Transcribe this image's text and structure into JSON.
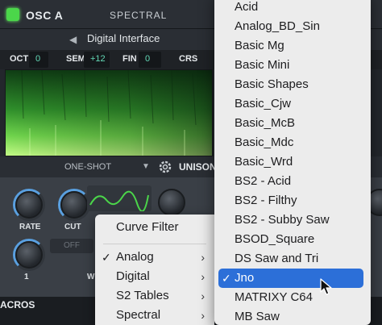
{
  "osc": {
    "title": "OSC A",
    "mode": "SPECTRAL",
    "wavetable": "Digital Interface",
    "oct_label": "OCT",
    "oct_value": "0",
    "sem_label": "SEM",
    "sem_value": "+12",
    "fin_label": "FIN",
    "fin_value": "0",
    "crs_label": "CRS",
    "playback": "ONE-SHOT",
    "unison": "UNISON",
    "accent_color": "#4bd64a"
  },
  "knobs": {
    "rate": "RATE",
    "cut": "CUT",
    "off": "OFF",
    "one": "1",
    "w": "W"
  },
  "macros": {
    "label": "ACROS"
  },
  "submenu": {
    "header": "Curve Filter",
    "items": [
      {
        "label": "Analog",
        "checked": true,
        "has_submenu": true
      },
      {
        "label": "Digital",
        "checked": false,
        "has_submenu": true
      },
      {
        "label": "S2 Tables",
        "checked": false,
        "has_submenu": true
      },
      {
        "label": "Spectral",
        "checked": false,
        "has_submenu": true
      }
    ]
  },
  "menu": {
    "items": [
      {
        "label": "Acid"
      },
      {
        "label": "Analog_BD_Sin"
      },
      {
        "label": "Basic Mg"
      },
      {
        "label": "Basic Mini"
      },
      {
        "label": "Basic Shapes"
      },
      {
        "label": "Basic_Cjw"
      },
      {
        "label": "Basic_McB"
      },
      {
        "label": "Basic_Mdc"
      },
      {
        "label": "Basic_Wrd"
      },
      {
        "label": "BS2 - Acid"
      },
      {
        "label": "BS2 - Filthy"
      },
      {
        "label": "BS2 - Subby Saw"
      },
      {
        "label": "BSOD_Square"
      },
      {
        "label": "DS Saw and Tri"
      },
      {
        "label": "Jno",
        "selected": true
      },
      {
        "label": "MATRIXY C64"
      },
      {
        "label": "MB Saw"
      }
    ],
    "selected_color": "#2c6fd8"
  }
}
